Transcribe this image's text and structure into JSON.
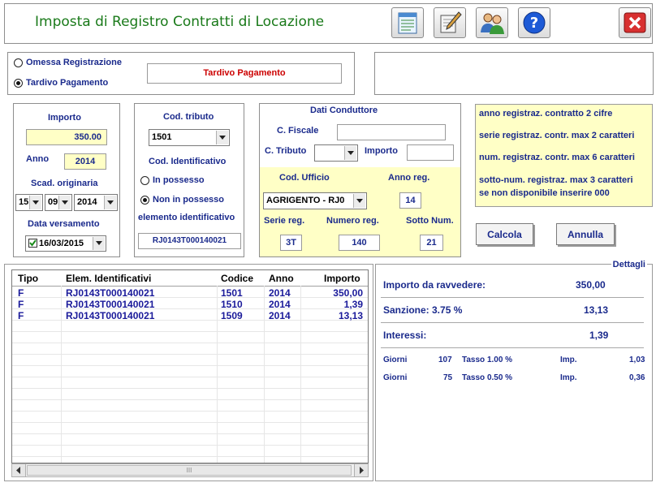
{
  "header": {
    "title": "Imposta di Registro Contratti di Locazione",
    "title_color": "#1a7a1a"
  },
  "mode": {
    "omessa_label": "Omessa Registrazione",
    "tardivo_label": "Tardivo Pagamento",
    "selected": "Tardivo Pagamento",
    "display": "Tardivo Pagamento"
  },
  "importo": {
    "importo_label": "Importo",
    "importo_value": "350.00",
    "anno_label": "Anno",
    "anno_value": "2014",
    "scadenza_label": "Scad. originaria",
    "scad_day": "15",
    "scad_month": "09",
    "scad_year": "2014",
    "versamento_label": "Data versamento",
    "versamento_value": "16/03/2015",
    "versamento_checked": true
  },
  "tributo": {
    "cod_tributo_label": "Cod. tributo",
    "cod_tributo_value": "1501",
    "cod_ident_label": "Cod. Identificativo",
    "in_possesso_label": "In possesso",
    "non_possesso_label": "Non in possesso",
    "elemento_label": "elemento identificativo",
    "elemento_value": "RJ0143T000140021",
    "selected": "Non in possesso"
  },
  "conduttore": {
    "title": "Dati Conduttore",
    "cfiscale_label": "C. Fiscale",
    "cfiscale_value": "",
    "ctributo_label": "C. Tributo",
    "ctributo_value": "",
    "importo_label": "Importo",
    "importo_value": "",
    "cod_ufficio_label": "Cod. Ufficio",
    "cod_ufficio_value": "AGRIGENTO - RJ0",
    "anno_reg_label": "Anno reg.",
    "anno_reg_value": "14",
    "serie_label": "Serie reg.",
    "serie_value": "3T",
    "numero_label": "Numero reg.",
    "numero_value": "140",
    "sotto_label": "Sotto Num.",
    "sotto_value": "21"
  },
  "notes": {
    "line1": "anno registraz. contratto  2 cifre",
    "line2": "serie registraz. contr. max 2 caratteri",
    "line3": "num. registraz. contr. max 6 caratteri",
    "line4": "sotto-num. registraz. max 3 caratteri",
    "line5": "se non disponibile inserire   000"
  },
  "buttons": {
    "calcola": "Calcola",
    "annulla": "Annulla"
  },
  "grid": {
    "headers": [
      "Tipo",
      "Elem. Identificativi",
      "Codice",
      "Anno",
      "Importo"
    ],
    "rows": [
      [
        "F",
        "RJ0143T000140021",
        "1501",
        "2014",
        "350,00"
      ],
      [
        "F",
        "RJ0143T000140021",
        "1510",
        "2014",
        "1,39"
      ],
      [
        "F",
        "RJ0143T000140021",
        "1509",
        "2014",
        "13,13"
      ]
    ],
    "scroll_grip": "III"
  },
  "dettagli": {
    "title": "Dettagli",
    "ravvedere_label": "Importo da ravvedere:",
    "ravvedere_value": "350,00",
    "sanzione_label": "Sanzione:  3.75 %",
    "sanzione_value": "13,13",
    "interessi_label": "Interessi:",
    "interessi_value": "1,39",
    "giorni_label": "Giorni",
    "imp_label": "Imp.",
    "rows": [
      {
        "giorni": "107",
        "tasso": "Tasso 1.00 %",
        "imp": "1,03"
      },
      {
        "giorni": "75",
        "tasso": "Tasso 0.50 %",
        "imp": "0,36"
      }
    ]
  },
  "icons": [
    "document-icon",
    "edit-pen-icon",
    "users-icon",
    "help-icon",
    "close-icon"
  ],
  "colors": {
    "label_blue": "#1a2a8c",
    "red_text": "#cc0000",
    "yellow_bg": "#ffffc6",
    "help_blue": "#1d5ad6",
    "close_red": "#d83030"
  }
}
